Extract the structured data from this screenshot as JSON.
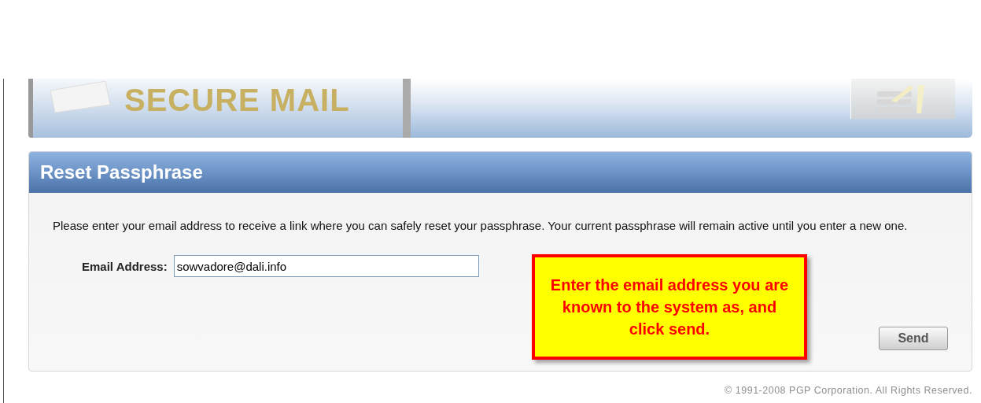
{
  "banner": {
    "logo_text": "SECURE MAIL"
  },
  "panel": {
    "title": "Reset Passphrase",
    "instructions": "Please enter your email address to receive a link where you can safely reset your passphrase. Your current passphrase will remain active until you enter a new one.",
    "email_field": {
      "label": "Email Address:",
      "value": "sowvadore@dali.info"
    },
    "send_button": "Send"
  },
  "callout": {
    "text": "Enter the email address you are known to the system as, and click send."
  },
  "footer": {
    "copyright": "© 1991-2008 PGP Corporation. All Rights Reserved."
  }
}
